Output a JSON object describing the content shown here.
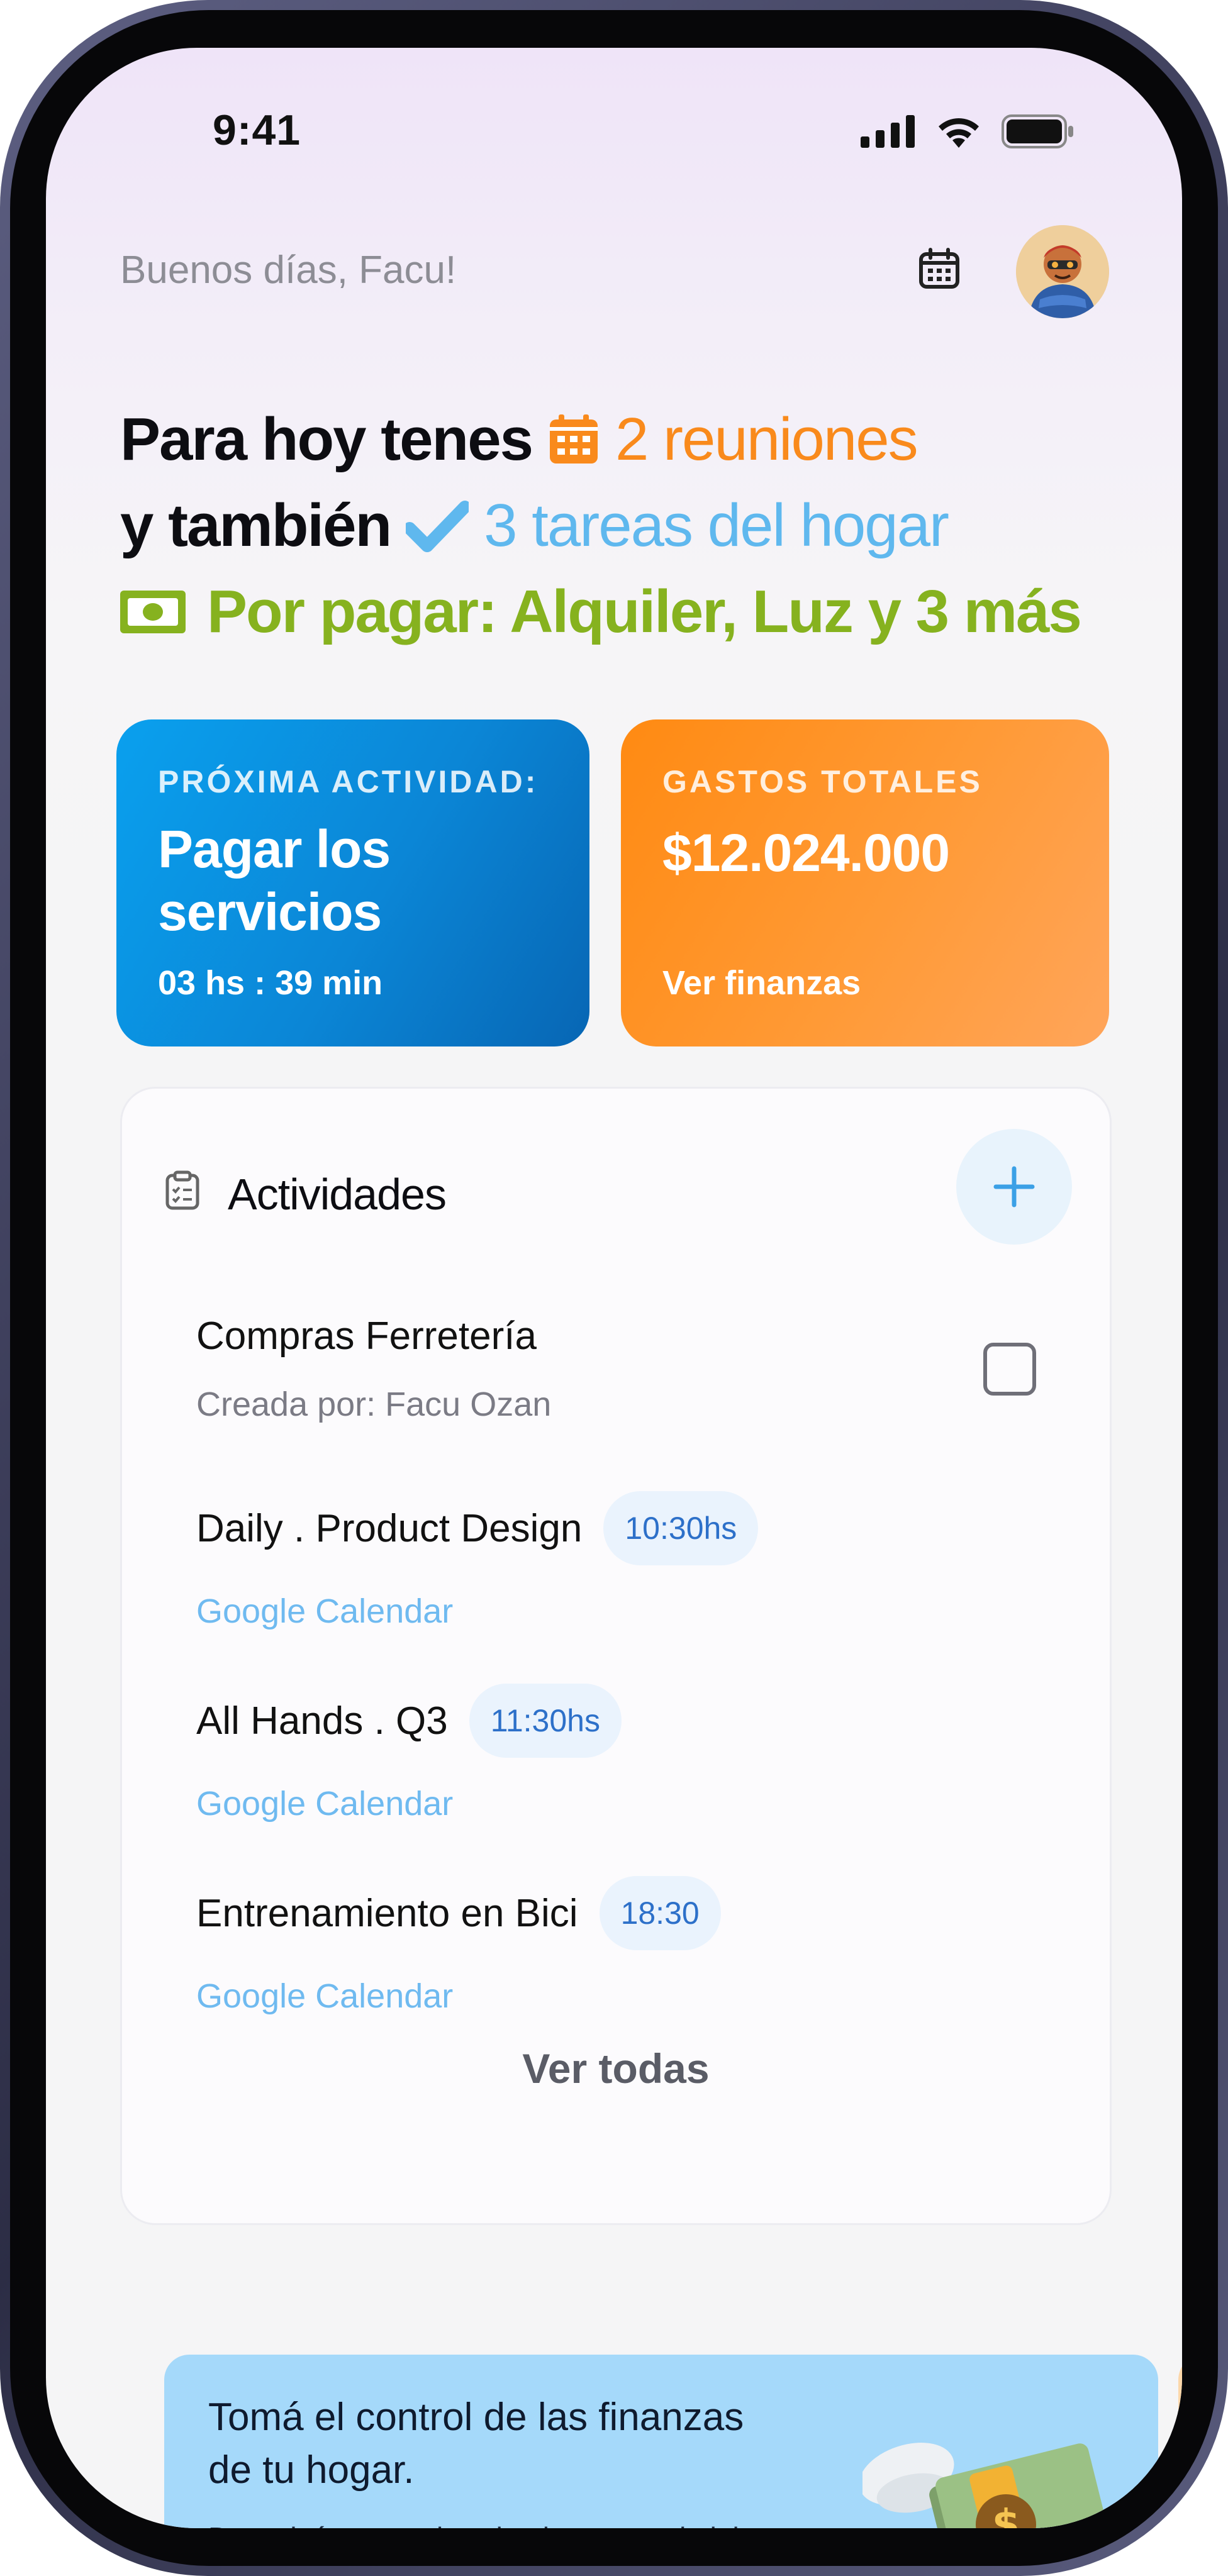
{
  "status_bar": {
    "time": "9:41"
  },
  "header": {
    "greeting": "Buenos días, Facu!"
  },
  "headline": {
    "line1_prefix": "Para hoy tenes",
    "line1_highlight": "2 reuniones",
    "line2_prefix": "y también",
    "line2_highlight": "3 tareas del hogar",
    "line3_text": "Por pagar: Alquiler, Luz y 3 más"
  },
  "cards": {
    "activity": {
      "eyebrow": "PRÓXIMA ACTIVIDAD:",
      "title": "Pagar los servicios",
      "countdown": "03 hs : 39 min"
    },
    "expenses": {
      "eyebrow": "GASTOS TOTALES",
      "amount": "$12.024.000",
      "link": "Ver finanzas"
    }
  },
  "activities": {
    "title": "Actividades",
    "items": [
      {
        "title": "Compras Ferretería",
        "subtitle": "Creada por: Facu Ozan"
      },
      {
        "title": "Daily . Product Design",
        "time": "10:30hs",
        "source": "Google Calendar"
      },
      {
        "title": "All Hands . Q3",
        "time": "11:30hs",
        "source": "Google Calendar"
      },
      {
        "title": "Entrenamiento en Bici",
        "time": "18:30",
        "source": "Google Calendar"
      }
    ],
    "see_all": "Ver todas"
  },
  "promo": {
    "title": "Tomá el control de las finanzas de tu hogar.",
    "body": "Descubrí estrategias simples para administrar mejor el dinero en familia y alcanzar tus metas."
  },
  "colors": {
    "orange": "#f98a1c",
    "blue": "#5fb8ee",
    "green": "#86b21f",
    "card_blue": "#0b86d6",
    "card_orange": "#ff8a12"
  }
}
